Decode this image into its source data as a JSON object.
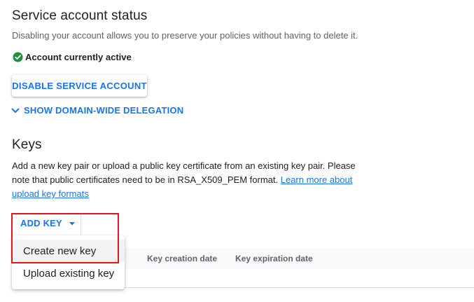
{
  "service_account_status": {
    "title": "Service account status",
    "description": "Disabling your account allows you to preserve your policies without having to delete it.",
    "status_text": "Account currently active",
    "status_color": "#1e8e3e",
    "disable_button": "DISABLE SERVICE ACCOUNT",
    "delegation_toggle": "SHOW DOMAIN-WIDE DELEGATION"
  },
  "keys": {
    "title": "Keys",
    "description_line1": "Add a new key pair or upload a public key certificate from an existing key pair. Please",
    "description_line2_pre": "note that public certificates need to be in RSA_X509_PEM format.",
    "learn_more_part1": "Learn more about",
    "learn_more_part2": "upload key formats",
    "add_key_button": "ADD KEY",
    "menu": {
      "items": [
        {
          "label": "Create new key"
        },
        {
          "label": "Upload existing key"
        }
      ]
    },
    "table": {
      "columns": [
        "Key creation date",
        "Key expiration date"
      ]
    }
  },
  "colors": {
    "accent": "#1a73e8",
    "highlight": "#e8141b"
  }
}
